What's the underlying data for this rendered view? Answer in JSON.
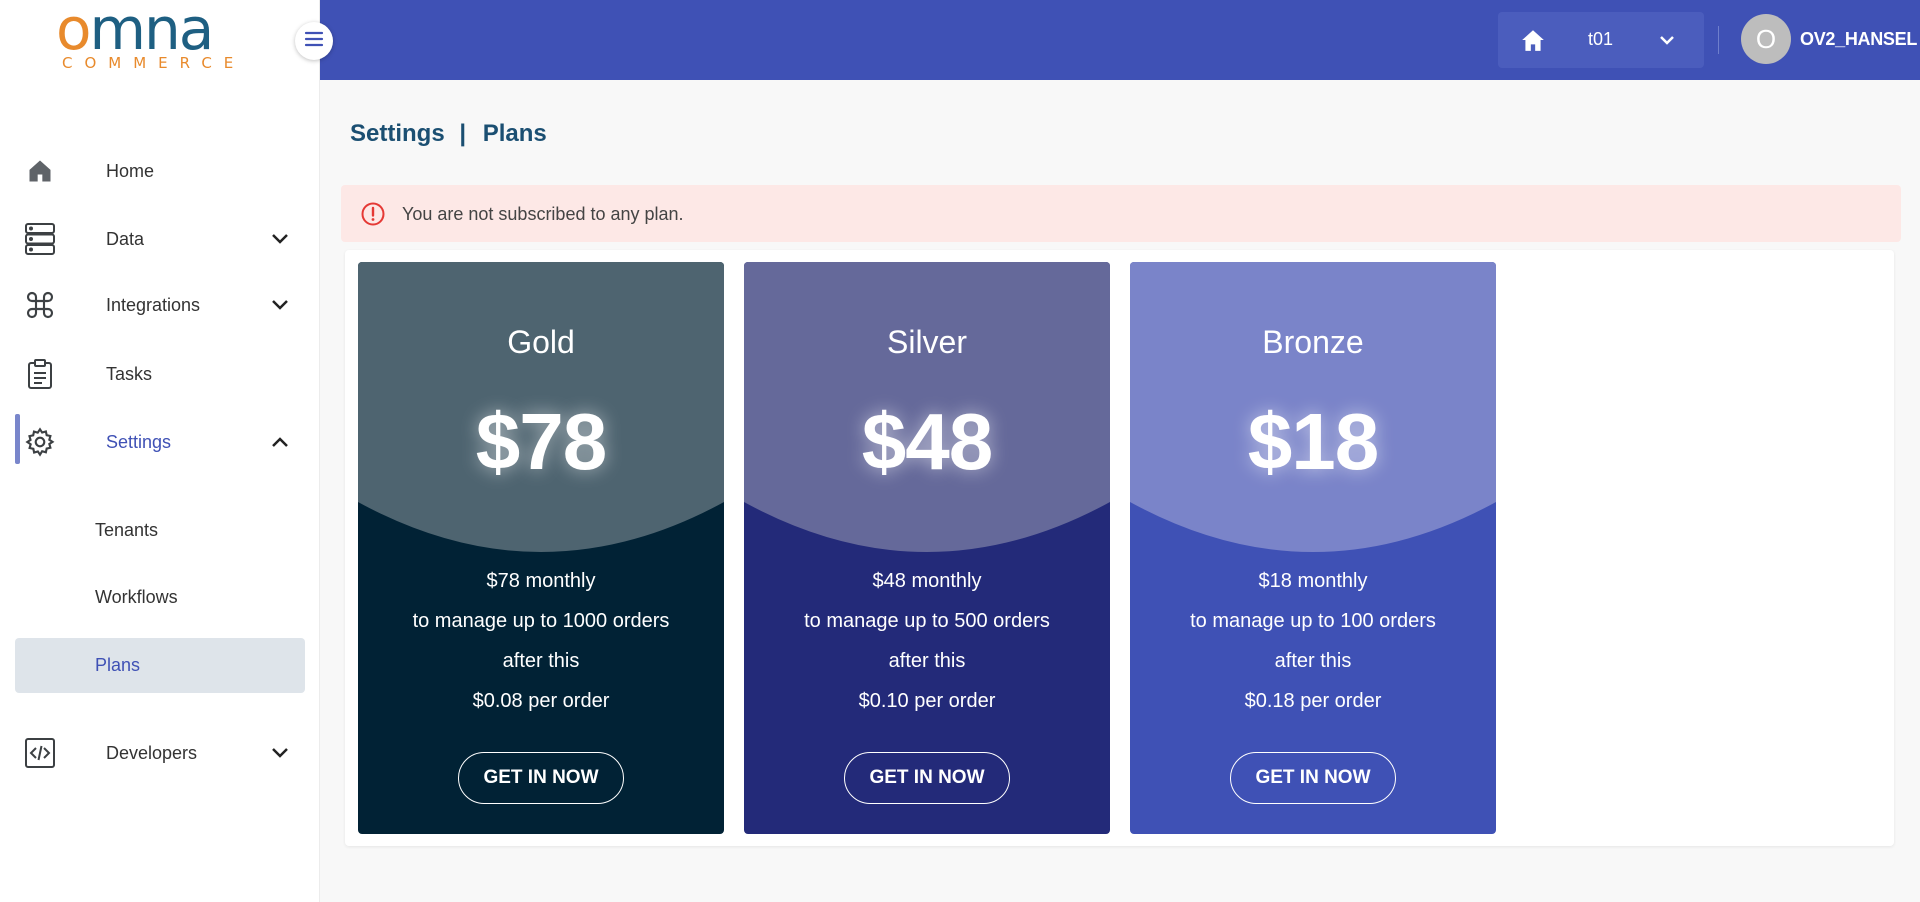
{
  "logo": {
    "main": "omna",
    "sub": "COMMERCE"
  },
  "sidebar": {
    "items": [
      {
        "label": "Home",
        "icon": "home-icon"
      },
      {
        "label": "Data",
        "icon": "database-icon"
      },
      {
        "label": "Integrations",
        "icon": "command-icon"
      },
      {
        "label": "Tasks",
        "icon": "clipboard-icon"
      },
      {
        "label": "Settings",
        "icon": "gear-icon"
      },
      {
        "label": "Developers",
        "icon": "code-icon"
      }
    ],
    "settings_sub": [
      {
        "label": "Tenants"
      },
      {
        "label": "Workflows"
      },
      {
        "label": "Plans"
      }
    ]
  },
  "topbar": {
    "tenant": "t01",
    "avatar_initial": "O",
    "username": "OV2_HANSEL"
  },
  "breadcrumb": {
    "section": "Settings",
    "separator": "|",
    "page": "Plans"
  },
  "alert": {
    "text": "You are not subscribed to any plan."
  },
  "plans": [
    {
      "name": "Gold",
      "price": "$78",
      "monthly": "$78 monthly",
      "manage": "to manage up to 1000 orders",
      "after": "after this",
      "per_order": "$0.08 per order",
      "button": "GET IN NOW"
    },
    {
      "name": "Silver",
      "price": "$48",
      "monthly": "$48 monthly",
      "manage": "to manage up to 500 orders",
      "after": "after this",
      "per_order": "$0.10 per order",
      "button": "GET IN NOW"
    },
    {
      "name": "Bronze",
      "price": "$18",
      "monthly": "$18 monthly",
      "manage": "to manage up to 100 orders",
      "after": "after this",
      "per_order": "$0.18 per order",
      "button": "GET IN NOW"
    }
  ],
  "colors": {
    "primary": "#3f51b5",
    "gold_top": "#4e6470",
    "gold_bottom": "#012235",
    "silver_top": "#65699a",
    "silver_bottom": "#232a79",
    "bronze_top": "#7a84c9",
    "bronze_bottom": "#3f51b5"
  }
}
